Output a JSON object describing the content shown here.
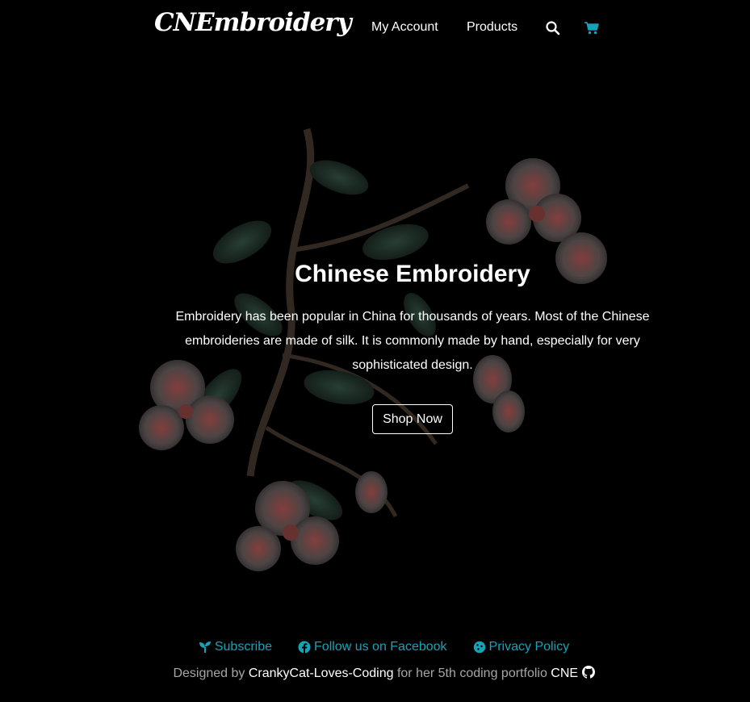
{
  "nav": {
    "logo": "CNEmbroidery",
    "links": [
      {
        "label": "My Account"
      },
      {
        "label": "Products"
      }
    ],
    "icons": [
      "search-icon",
      "cart-icon"
    ],
    "cart_color": "#17a2b8"
  },
  "hero": {
    "title": "Chinese Embroidery",
    "text": "Embroidery has been popular in China for thousands of years. Most of the Chinese embroideries are made of silk. It is commonly made by hand, especially for very sophisticated design.",
    "button": "Shop Now"
  },
  "footer": {
    "links": [
      {
        "label": "Subscribe",
        "icon": "seedling-icon"
      },
      {
        "label": "Follow us on Facebook",
        "icon": "facebook-icon"
      },
      {
        "label": "Privacy Policy",
        "icon": "cookie-icon"
      }
    ],
    "link_color": "#17a2b8",
    "credits": {
      "prefix": "Designed by",
      "author": "CrankyCat-Loves-Coding",
      "middle": "for her 5th coding portfolio",
      "project": "CNE",
      "icon": "github-icon"
    }
  }
}
